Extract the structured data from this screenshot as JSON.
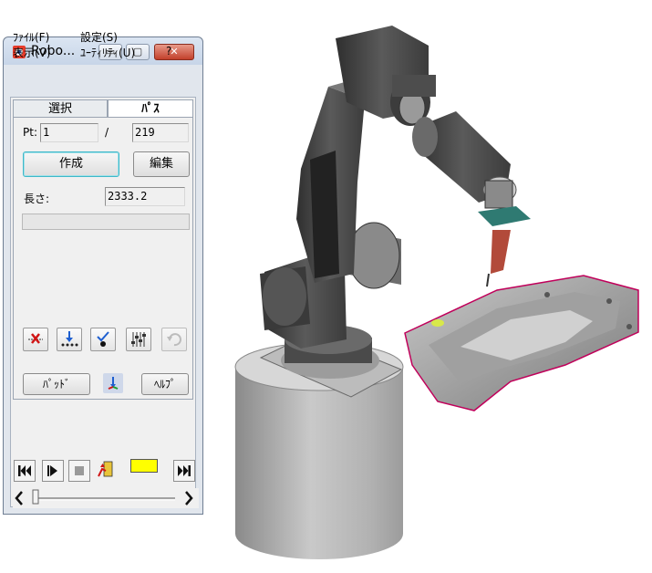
{
  "window": {
    "title": "Robo...",
    "buttons": {
      "minimize": "▭",
      "maximize": "▢",
      "close": "✕"
    }
  },
  "menu": {
    "file": "ﾌｧｲﾙ(F)",
    "settings": "設定(S)",
    "view": "表示(V)",
    "utility": "ﾕｰﾃｨﾘﾃｨ(U)",
    "help": "?"
  },
  "tabs": {
    "select": "選択",
    "path": "ﾊﾟｽ"
  },
  "path_tab": {
    "pt_label": "Pt:",
    "pt_value": "1",
    "separator": "/",
    "pt_total": "219",
    "create_button": "作成",
    "edit_button": "編集",
    "length_label": "長さ:",
    "length_value": "2333.2",
    "progress": 0
  },
  "tool_icons": [
    "delete-point-icon",
    "insert-point-icon",
    "move-point-icon",
    "adjust-icon",
    "undo-icon"
  ],
  "bottom": {
    "pad_button": "ﾊﾟｯﾄﾞ",
    "help_button": "ﾍﾙﾌﾟ"
  },
  "transport": {
    "status_color": "#ffff00"
  },
  "colors": {
    "workpiece_edge": "#c0005a",
    "marker": "#d8e84a",
    "tool_holder": "#2f7a72",
    "tool": "#b24a3a"
  }
}
